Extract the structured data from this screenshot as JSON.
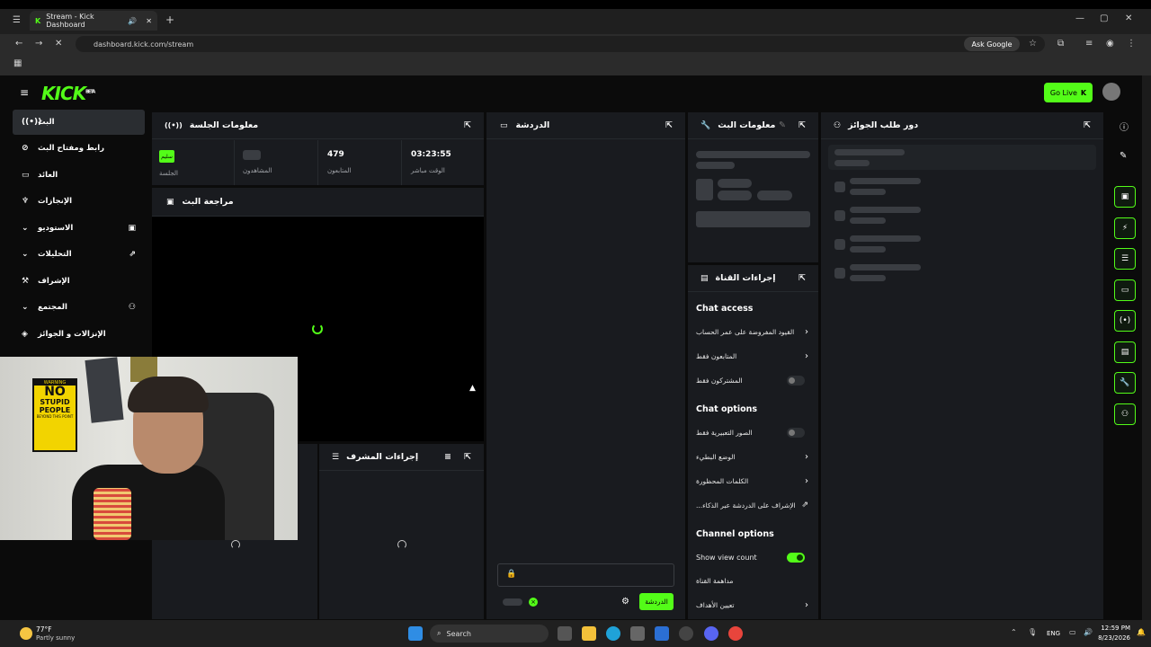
{
  "browser": {
    "tab_title": "Stream - Kick Dashboard",
    "url": "dashboard.kick.com/stream",
    "ask_google": "Ask Google",
    "new_tab": "+"
  },
  "app": {
    "logo": "KICK",
    "logo_badge": "BETA",
    "go_live": "Go Live"
  },
  "sidebar": {
    "items": [
      {
        "label": "البث",
        "icon": "stream-icon"
      },
      {
        "label": "رابط ومفتاح البث",
        "icon": "link-icon"
      },
      {
        "label": "العائد",
        "icon": "money-icon"
      },
      {
        "label": "الإنجازات",
        "icon": "trophy-icon"
      },
      {
        "label": "الاستوديو",
        "icon": "studio-icon"
      },
      {
        "label": "التحليلات",
        "icon": "analytics-icon"
      },
      {
        "label": "الإشراف",
        "icon": "moderation-icon"
      },
      {
        "label": "المجتمع",
        "icon": "community-icon"
      },
      {
        "label": "الإنزالات و الجوائز",
        "icon": "drops-icon"
      }
    ]
  },
  "session": {
    "title": "معلومات الجلسة",
    "stats": [
      {
        "value": "03:23:55",
        "label": "الوقت مباشر"
      },
      {
        "value": "479",
        "label": "المتابعون"
      },
      {
        "value": "",
        "label": "المشاهدون"
      },
      {
        "value": "سليم",
        "label": "الجلسة"
      }
    ]
  },
  "preview": {
    "title": "مراجعة البث"
  },
  "mod_actions": {
    "title": "إجراءات المشرف"
  },
  "chat": {
    "title": "الدردشة",
    "send": "الدردشة"
  },
  "stream_info": {
    "title": "معلومات البث"
  },
  "channel_actions": {
    "title": "إجراءات القناة",
    "chat_access": "Chat access",
    "access_rows": [
      {
        "label": "القيود المفروضة على عمر الحساب",
        "control": "chevron"
      },
      {
        "label": "المتابعون فقط",
        "control": "chevron"
      },
      {
        "label": "المشتركون فقط",
        "control": "toggle",
        "on": false
      }
    ],
    "chat_options": "Chat options",
    "option_rows": [
      {
        "label": "الصور التعبيرية فقط",
        "control": "toggle",
        "on": false
      },
      {
        "label": "الوضع البطيء",
        "control": "chevron"
      },
      {
        "label": "الكلمات المحظورة",
        "control": "chevron"
      },
      {
        "label": "...الإشراف على الدردشة عبر الذكاء",
        "control": "external"
      }
    ],
    "channel_options": "Channel options",
    "channel_rows": [
      {
        "label": "Show view count",
        "control": "toggle",
        "on": true
      },
      {
        "label": "مداهمة القناة",
        "control": "none"
      },
      {
        "label": "تعيين الأهداف",
        "control": "chevron"
      }
    ]
  },
  "rewards": {
    "title": "دور طلب الجوائز"
  },
  "taskbar": {
    "temp": "77°F",
    "weather": "Partly sunny",
    "search": "Search",
    "lang": "ENG",
    "time": "12:59 PM",
    "date": "8/23/2026"
  },
  "webcam_poster": {
    "line1": "NO",
    "line2": "STUPID",
    "line3": "PEOPLE",
    "line4": "BEYOND THIS POINT",
    "warning": "WARNING"
  },
  "colors": {
    "accent": "#53fc18",
    "panel": "#191b1f",
    "bg": "#0b0b0b"
  }
}
